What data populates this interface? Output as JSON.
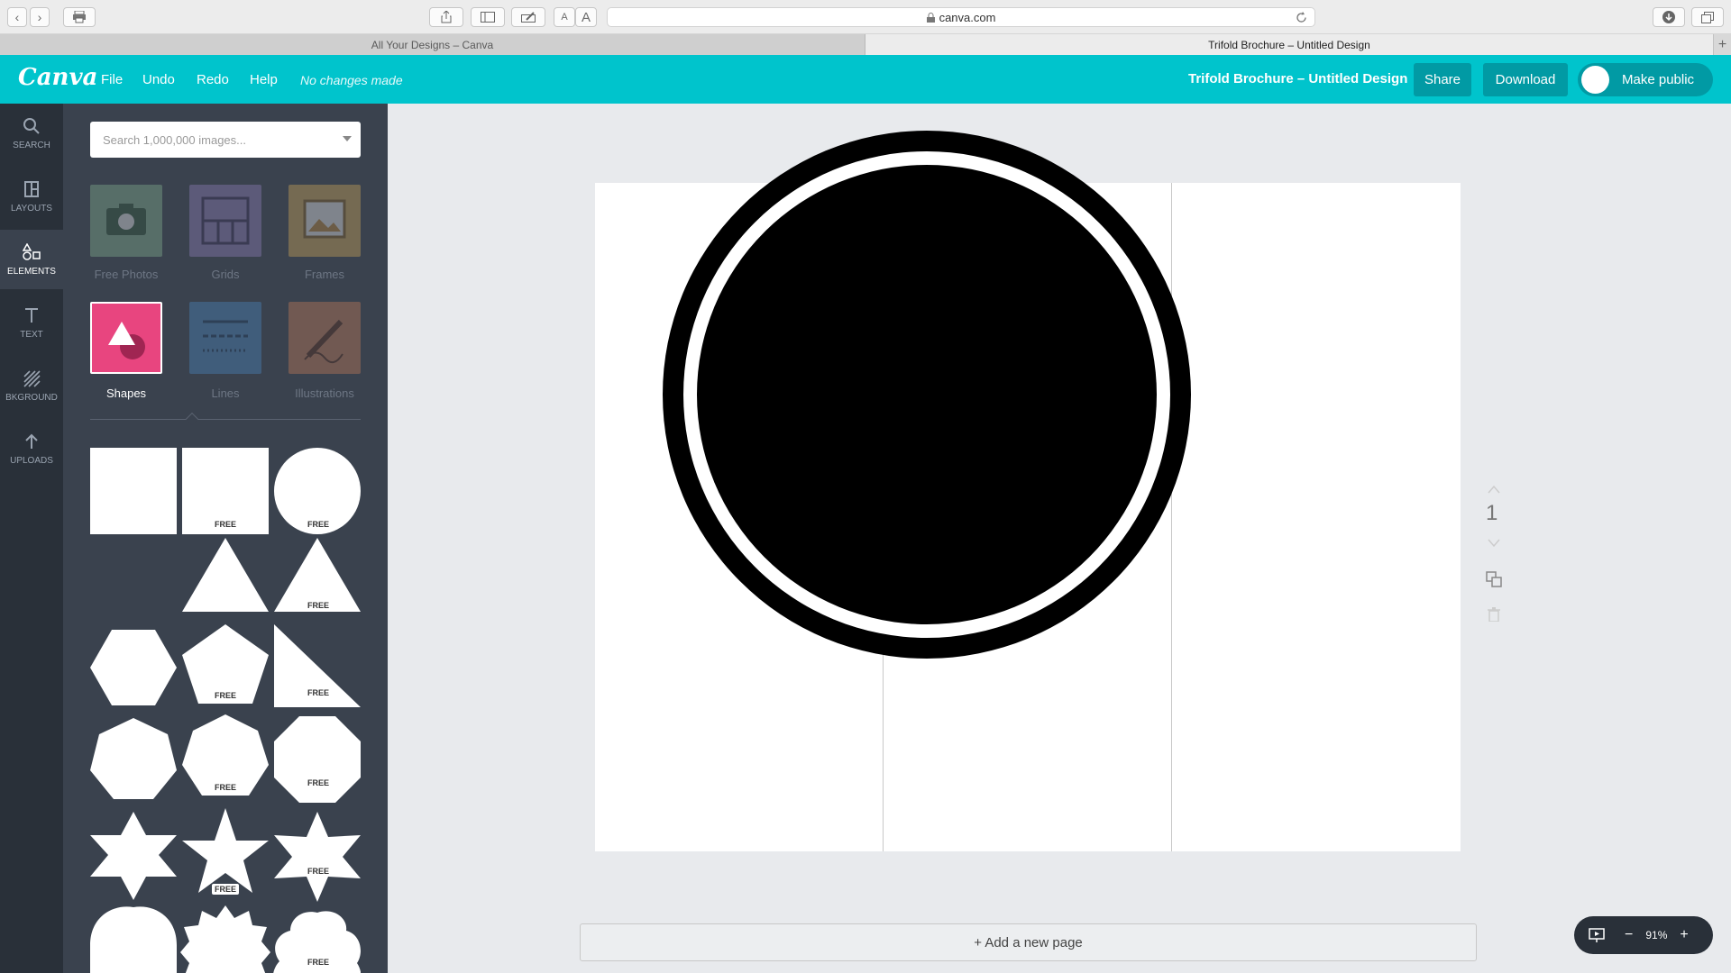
{
  "browser": {
    "url": "canva.com",
    "tabs": [
      "All Your Designs – Canva",
      "Trifold Brochure – Untitled Design"
    ],
    "new_tab": "+"
  },
  "header": {
    "logo": "Canva",
    "menu": [
      "File",
      "Undo",
      "Redo",
      "Help"
    ],
    "status": "No changes made",
    "doc_title": "Trifold Brochure – Untitled Design",
    "share": "Share",
    "download": "Download",
    "make_public": "Make public",
    "accent_color": "#00c4cc"
  },
  "nav": [
    {
      "label": "SEARCH",
      "icon": "search-icon"
    },
    {
      "label": "LAYOUTS",
      "icon": "layouts-icon"
    },
    {
      "label": "ELEMENTS",
      "icon": "elements-icon"
    },
    {
      "label": "TEXT",
      "icon": "text-icon"
    },
    {
      "label": "BKGROUND",
      "icon": "background-icon"
    },
    {
      "label": "UPLOADS",
      "icon": "upload-icon"
    }
  ],
  "panel": {
    "search_placeholder": "Search 1,000,000 images...",
    "categories": [
      "Free Photos",
      "Grids",
      "Frames",
      "Shapes",
      "Lines",
      "Illustrations"
    ],
    "selected_category": "Shapes",
    "free_badge": "FREE"
  },
  "canvas": {
    "page_number": "1",
    "add_page": "+ Add a new page",
    "zoom": "91%",
    "zoom_minus": "−",
    "zoom_plus": "+"
  }
}
